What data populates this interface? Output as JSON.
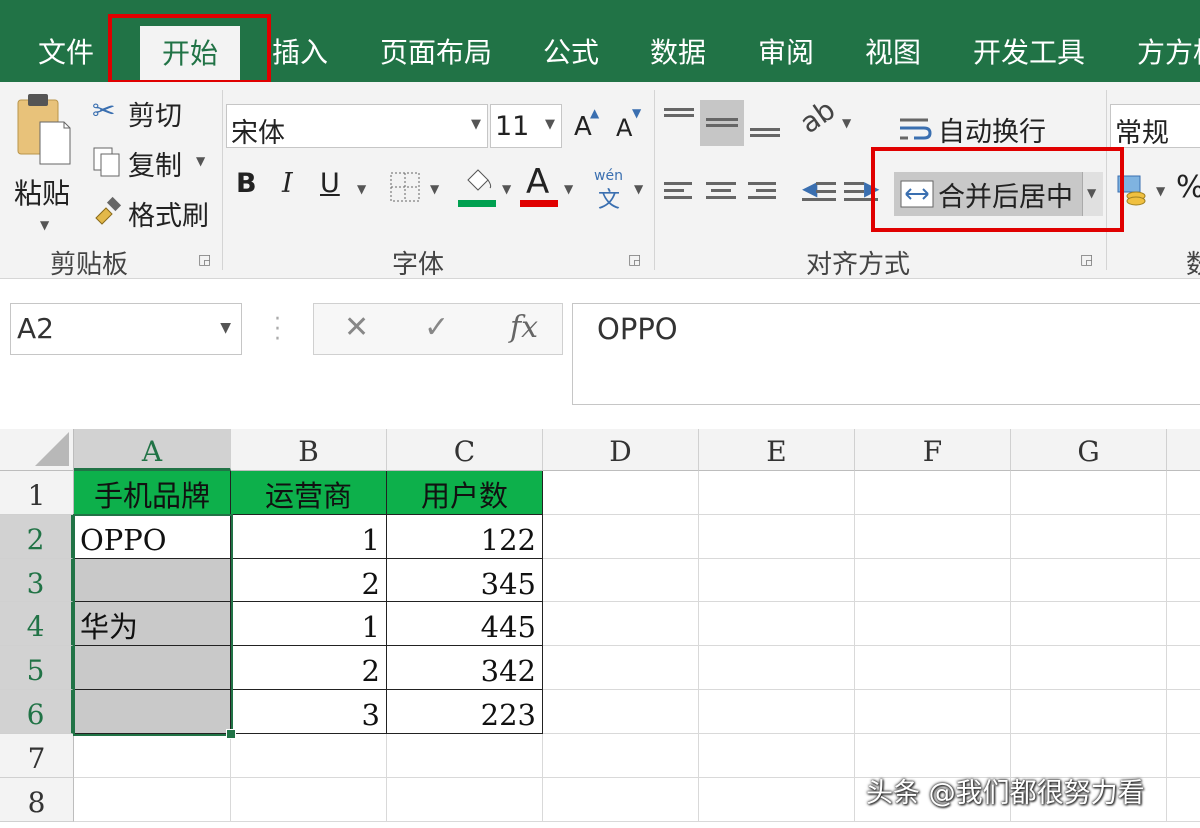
{
  "tabs": [
    "文件",
    "开始",
    "插入",
    "页面布局",
    "公式",
    "数据",
    "审阅",
    "视图",
    "开发工具",
    "方方格"
  ],
  "active_tab": "开始",
  "ribbon": {
    "clipboard": {
      "paste": "粘贴",
      "cut": "剪切",
      "copy": "复制",
      "format_painter": "格式刷",
      "group": "剪贴板"
    },
    "font": {
      "name": "宋体",
      "size": "11",
      "bold": "B",
      "italic": "I",
      "underline": "U",
      "font_color_glyph": "A",
      "phonetic_top": "wén",
      "phonetic_bottom": "文",
      "group": "字体",
      "grow": "A",
      "shrink": "A"
    },
    "alignment": {
      "wrap": "自动换行",
      "merge": "合并后居中",
      "group": "对齐方式"
    },
    "number": {
      "format": "常规",
      "percent": "%",
      "group_partial": "数"
    }
  },
  "formula_bar": {
    "name_box": "A2",
    "cancel": "✕",
    "enter": "✓",
    "fx": "fx",
    "value": "OPPO"
  },
  "columns": [
    "A",
    "B",
    "C",
    "D",
    "E",
    "F",
    "G"
  ],
  "rows": [
    "1",
    "2",
    "3",
    "4",
    "5",
    "6",
    "7",
    "8"
  ],
  "sheet": {
    "header": [
      "手机品牌",
      "运营商",
      "用户数"
    ],
    "rows": [
      {
        "a": "OPPO",
        "b": "1",
        "c": "122"
      },
      {
        "a": "",
        "b": "2",
        "c": "345"
      },
      {
        "a": "华为",
        "b": "1",
        "c": "445"
      },
      {
        "a": "",
        "b": "2",
        "c": "342"
      },
      {
        "a": "",
        "b": "3",
        "c": "223"
      }
    ]
  },
  "watermark": "头条 @我们都很努力看",
  "colors": {
    "excel_green": "#217346",
    "header_fill": "#0db04b",
    "highlight_red": "#e00000",
    "selection_gray": "#c9c9c9",
    "font_color_bar": "#e00000",
    "fill_color_bar": "#00a050"
  }
}
